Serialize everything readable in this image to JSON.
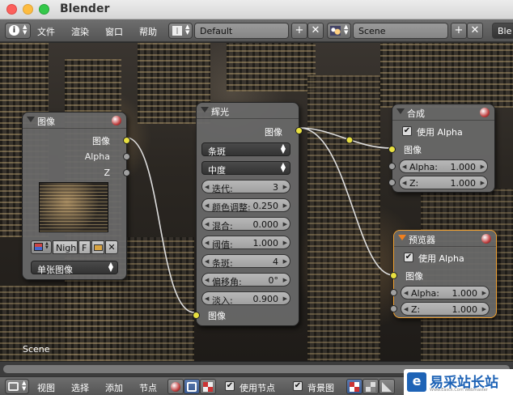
{
  "window": {
    "title": "Blender"
  },
  "header": {
    "menus": [
      "文件",
      "渲染",
      "窗口",
      "帮助"
    ],
    "layout_value": "Default",
    "scene_value": "Scene",
    "engine_value": "Ble"
  },
  "nodes": {
    "image": {
      "title": "图像",
      "outputs": [
        "图像",
        "Alpha",
        "Z"
      ],
      "file_name": "Nigh",
      "file_flag": "F",
      "source_value": "单张图像"
    },
    "glare": {
      "title": "辉光",
      "output": "图像",
      "glare_type": "条斑",
      "quality": "中度",
      "fields": [
        {
          "label": "迭代:",
          "value": "3"
        },
        {
          "label": "颜色调整:",
          "value": "0.250"
        },
        {
          "label": "混合:",
          "value": "0.000"
        },
        {
          "label": "阈值:",
          "value": "1.000"
        },
        {
          "label": "条斑:",
          "value": "4"
        },
        {
          "label": "偏移角:",
          "value": "0°"
        },
        {
          "label": "淡入:",
          "value": "0.900"
        }
      ],
      "input": "图像"
    },
    "composite": {
      "title": "合成",
      "use_alpha": "使用 Alpha",
      "input": "图像",
      "fields": [
        {
          "label": "Alpha:",
          "value": "1.000"
        },
        {
          "label": "Z:",
          "value": "1.000"
        }
      ]
    },
    "viewer": {
      "title": "预览器",
      "use_alpha": "使用 Alpha",
      "input": "图像",
      "fields": [
        {
          "label": "Alpha:",
          "value": "1.000"
        },
        {
          "label": "Z:",
          "value": "1.000"
        }
      ]
    }
  },
  "canvas": {
    "scene_label": "Scene"
  },
  "footer": {
    "menus": [
      "视图",
      "选择",
      "添加",
      "节点"
    ],
    "use_nodes": "使用节点",
    "backdrop": "背景图"
  },
  "watermark": {
    "text": "易采站长站",
    "sub": "Www.Easck.Com Webmaster"
  },
  "colors": {
    "socket_image": "#e8e040",
    "socket_value": "#a0a0a0",
    "active_node": "#f0a030"
  }
}
